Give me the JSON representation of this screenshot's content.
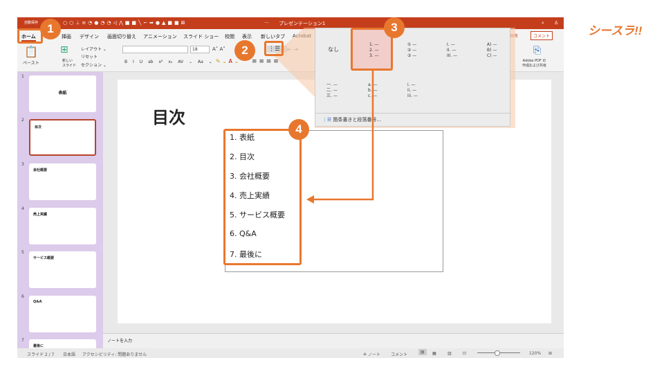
{
  "titlebar": {
    "autosave": "自動保存",
    "title": "プレゼンテーション1",
    "more": "···"
  },
  "tabs": [
    "ホーム",
    "挿画",
    "デザイン",
    "画面切り替え",
    "アニメーション",
    "スライド ショー",
    "校閲",
    "表示",
    "新しいタブ",
    "Acrobat"
  ],
  "ribbon": {
    "paste": "ペースト",
    "new_slide": "新しい\nスライド",
    "layout": "レイアウト ⌄",
    "reset": "リセット",
    "section": "セクション ⌄",
    "font_size": "18",
    "format": [
      "B",
      "I",
      "U",
      "ab",
      "x²",
      "x₂",
      "AV ⌄",
      "Aa ⌄"
    ],
    "share": "共有",
    "comment": "コメント",
    "adobe": "Adobe PDF の\n作成および共有"
  },
  "dropdown": {
    "none": "なし",
    "options": [
      [
        "1. —",
        "2. —",
        "3. —"
      ],
      [
        "① —",
        "② —",
        "③ —"
      ],
      [
        "I. —",
        "II. —",
        "III. —"
      ],
      [
        "A) —",
        "B) —",
        "C) —"
      ],
      [
        "一. —",
        "二. —",
        "三. —"
      ],
      [
        "a. —",
        "b. —",
        "c. —"
      ],
      [
        "i. —",
        "ii. —",
        "iii. —"
      ]
    ],
    "footer": "箇条書きと段落番号..."
  },
  "slides": [
    {
      "num": "1",
      "title": "表紙"
    },
    {
      "num": "2",
      "title": "目次"
    },
    {
      "num": "3",
      "title": "会社概要"
    },
    {
      "num": "4",
      "title": "売上実績"
    },
    {
      "num": "5",
      "title": "サービス概要"
    },
    {
      "num": "6",
      "title": "Q&A"
    },
    {
      "num": "7",
      "title": "最後に"
    }
  ],
  "slide": {
    "title": "目次",
    "items": [
      "1.  表紙",
      "2.  目次",
      "3.  会社概要",
      "4.  売上実績",
      "5.  サービス概要",
      "6.  Q&A",
      "7.  最後に"
    ]
  },
  "notes": "ノートを入力",
  "status": {
    "slide": "スライド 2 / 7",
    "lang": "日本語",
    "access": "アクセシビリティ: 問題ありません",
    "notes": "≙ ノート",
    "comments": "コメント",
    "zoom": "120%"
  },
  "callouts": [
    "1",
    "2",
    "3",
    "4"
  ],
  "brand": "シースラ!!",
  "colors": {
    "accent": "#e8772e",
    "title": "#c43e1c"
  }
}
